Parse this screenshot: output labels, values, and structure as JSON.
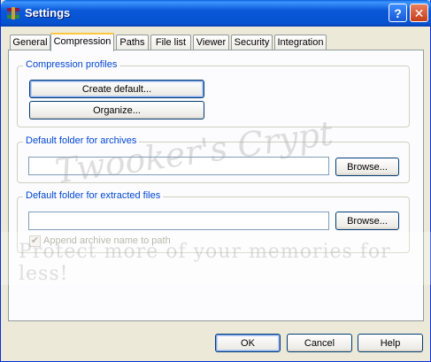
{
  "window": {
    "title": "Settings"
  },
  "titlebar": {
    "help_glyph": "?",
    "close_glyph": "✕"
  },
  "tabs": [
    {
      "label": "General"
    },
    {
      "label": "Compression",
      "active": true
    },
    {
      "label": "Paths"
    },
    {
      "label": "File list"
    },
    {
      "label": "Viewer"
    },
    {
      "label": "Security"
    },
    {
      "label": "Integration"
    }
  ],
  "compression_profiles": {
    "label": "Compression profiles",
    "create_default_label": "Create default...",
    "organize_label": "Organize..."
  },
  "default_archive_folder": {
    "label": "Default folder for archives",
    "value": "",
    "browse_label": "Browse..."
  },
  "default_extract_folder": {
    "label": "Default folder for extracted files",
    "value": "",
    "browse_label": "Browse...",
    "append_name_label": "Append archive name to path",
    "append_name_checked": true
  },
  "footer": {
    "ok_label": "OK",
    "cancel_label": "Cancel",
    "help_label": "Help"
  },
  "watermark": {
    "line1": "Twooker's Crypt",
    "line2": "Protect more of your memories for less!"
  },
  "colors": {
    "title_blue": "#0a57d8",
    "group_label": "#0046d5",
    "arrow_red": "#e0001b",
    "active_tab_accent": "#ffc83c"
  }
}
